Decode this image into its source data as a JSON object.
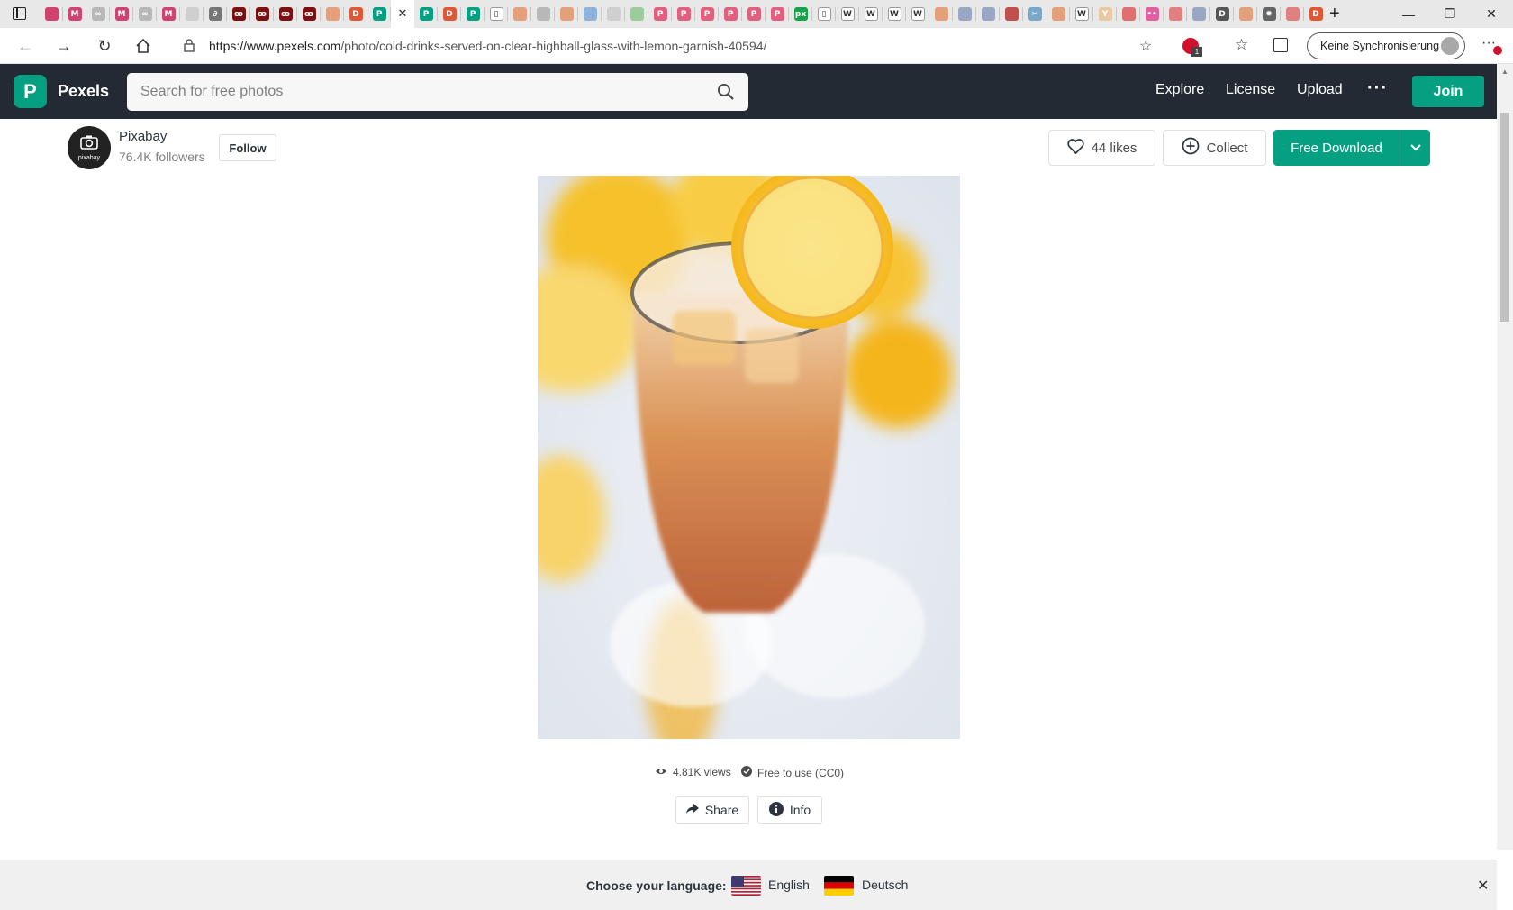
{
  "browser": {
    "tabs": [
      {
        "icon": "mail-icon",
        "color": "#d0436f",
        "glyph": ""
      },
      {
        "icon": "mail-icon",
        "color": "#d0436f",
        "glyph": "M"
      },
      {
        "icon": "link-icon",
        "color": "#b8b8b8",
        "glyph": "∞"
      },
      {
        "icon": "mail-icon",
        "color": "#d0436f",
        "glyph": "M"
      },
      {
        "icon": "link-icon",
        "color": "#b8b8b8",
        "glyph": "∞"
      },
      {
        "icon": "mail-icon",
        "color": "#d0436f",
        "glyph": "M"
      },
      {
        "icon": "page-icon",
        "color": "#cfcfcf",
        "glyph": ""
      },
      {
        "icon": "dev-icon",
        "color": "#777777",
        "glyph": "∂"
      },
      {
        "icon": "cherry-icon",
        "color": "#7a1010",
        "glyph": "ꝏ"
      },
      {
        "icon": "cherry-icon",
        "color": "#7a1010",
        "glyph": "ꝏ"
      },
      {
        "icon": "cherry-icon",
        "color": "#7a1010",
        "glyph": "ꝏ"
      },
      {
        "icon": "cherry-icon",
        "color": "#7a1010",
        "glyph": "ꝏ"
      },
      {
        "icon": "duck-icon",
        "color": "#e3a07a",
        "glyph": ""
      },
      {
        "icon": "duck-icon",
        "color": "#de5833",
        "glyph": "D"
      },
      {
        "icon": "pexels-icon",
        "color": "#05a081",
        "glyph": "P"
      },
      {
        "icon": "close-icon",
        "color": "#ffffff",
        "glyph": "✕",
        "active": true
      },
      {
        "icon": "pexels-icon",
        "color": "#05a081",
        "glyph": "P"
      },
      {
        "icon": "duck-icon",
        "color": "#de5833",
        "glyph": "D"
      },
      {
        "icon": "pexels-icon",
        "color": "#05a081",
        "glyph": "P"
      },
      {
        "icon": "page-icon",
        "color": "#ffffff",
        "glyph": "▯"
      },
      {
        "icon": "duck-icon",
        "color": "#e3a07a",
        "glyph": ""
      },
      {
        "icon": "tool-icon",
        "color": "#b8b8b8",
        "glyph": ""
      },
      {
        "icon": "duck-icon",
        "color": "#e3a07a",
        "glyph": ""
      },
      {
        "icon": "loop-icon",
        "color": "#8fb3d9",
        "glyph": ""
      },
      {
        "icon": "page-icon",
        "color": "#cfcfcf",
        "glyph": ""
      },
      {
        "icon": "chat-icon",
        "color": "#9ccc9c",
        "glyph": ""
      },
      {
        "icon": "pinterest-icon",
        "color": "#e0607e",
        "glyph": "P"
      },
      {
        "icon": "pinterest-icon",
        "color": "#e0607e",
        "glyph": "P"
      },
      {
        "icon": "pinterest-icon",
        "color": "#e0607e",
        "glyph": "P"
      },
      {
        "icon": "pinterest-icon",
        "color": "#e0607e",
        "glyph": "P"
      },
      {
        "icon": "pinterest-icon",
        "color": "#e0607e",
        "glyph": "P"
      },
      {
        "icon": "pinterest-icon",
        "color": "#e0607e",
        "glyph": "P"
      },
      {
        "icon": "px-icon",
        "color": "#16a34a",
        "glyph": "px"
      },
      {
        "icon": "page-icon",
        "color": "#ffffff",
        "glyph": "▯"
      },
      {
        "icon": "wikipedia-icon",
        "color": "#ffffff",
        "glyph": "W"
      },
      {
        "icon": "wikipedia-icon",
        "color": "#ffffff",
        "glyph": "W"
      },
      {
        "icon": "wikipedia-icon",
        "color": "#ffffff",
        "glyph": "W"
      },
      {
        "icon": "wikipedia-icon",
        "color": "#ffffff",
        "glyph": "W"
      },
      {
        "icon": "duck-icon",
        "color": "#e3a07a",
        "glyph": ""
      },
      {
        "icon": "drop-icon",
        "color": "#9aa7c4",
        "glyph": ""
      },
      {
        "icon": "drop-icon",
        "color": "#9aa7c4",
        "glyph": ""
      },
      {
        "icon": "image-icon",
        "color": "#c0504d",
        "glyph": ""
      },
      {
        "icon": "scissors-icon",
        "color": "#7aa7c7",
        "glyph": "✂"
      },
      {
        "icon": "duck-icon",
        "color": "#e3a07a",
        "glyph": ""
      },
      {
        "icon": "wikipedia-icon",
        "color": "#ffffff",
        "glyph": "W"
      },
      {
        "icon": "yahoo-icon",
        "color": "#e8c9a3",
        "glyph": "Y"
      },
      {
        "icon": "record-icon",
        "color": "#e07070",
        "glyph": ""
      },
      {
        "icon": "flickr-icon",
        "color": "#e05fa0",
        "glyph": "••"
      },
      {
        "icon": "spiral-icon",
        "color": "#e08080",
        "glyph": ""
      },
      {
        "icon": "drop-icon",
        "color": "#9aa7c4",
        "glyph": ""
      },
      {
        "icon": "d-icon",
        "color": "#555555",
        "glyph": "D"
      },
      {
        "icon": "duck-icon",
        "color": "#e3a07a",
        "glyph": ""
      },
      {
        "icon": "gear-icon",
        "color": "#666666",
        "glyph": "✹"
      },
      {
        "icon": "pen-icon",
        "color": "#e08080",
        "glyph": ""
      },
      {
        "icon": "duck-icon",
        "color": "#de5833",
        "glyph": "D"
      }
    ],
    "url_host": "https://www.pexels.com",
    "url_path": "/photo/cold-drinks-served-on-clear-highball-glass-with-lemon-garnish-40594/",
    "sync_label": "Keine Synchronisierung"
  },
  "header": {
    "logo_letter": "P",
    "logo_text": "Pexels",
    "search_placeholder": "Search for free photos",
    "nav": {
      "explore": "Explore",
      "license": "License",
      "upload": "Upload",
      "more": "···",
      "join": "Join"
    }
  },
  "author": {
    "name": "Pixabay",
    "followers": "76.4K followers",
    "avatar_text": "pixabay",
    "follow_label": "Follow"
  },
  "actions": {
    "likes": "44 likes",
    "collect": "Collect",
    "download": "Free Download"
  },
  "photo_meta": {
    "views": "4.81K views",
    "license": "Free to use (CC0)"
  },
  "share": {
    "share_label": "Share",
    "info_label": "Info"
  },
  "language_bar": {
    "label": "Choose your language:",
    "english": "English",
    "deutsch": "Deutsch"
  },
  "colors": {
    "brand": "#05a081",
    "header_bg": "#232a34"
  }
}
